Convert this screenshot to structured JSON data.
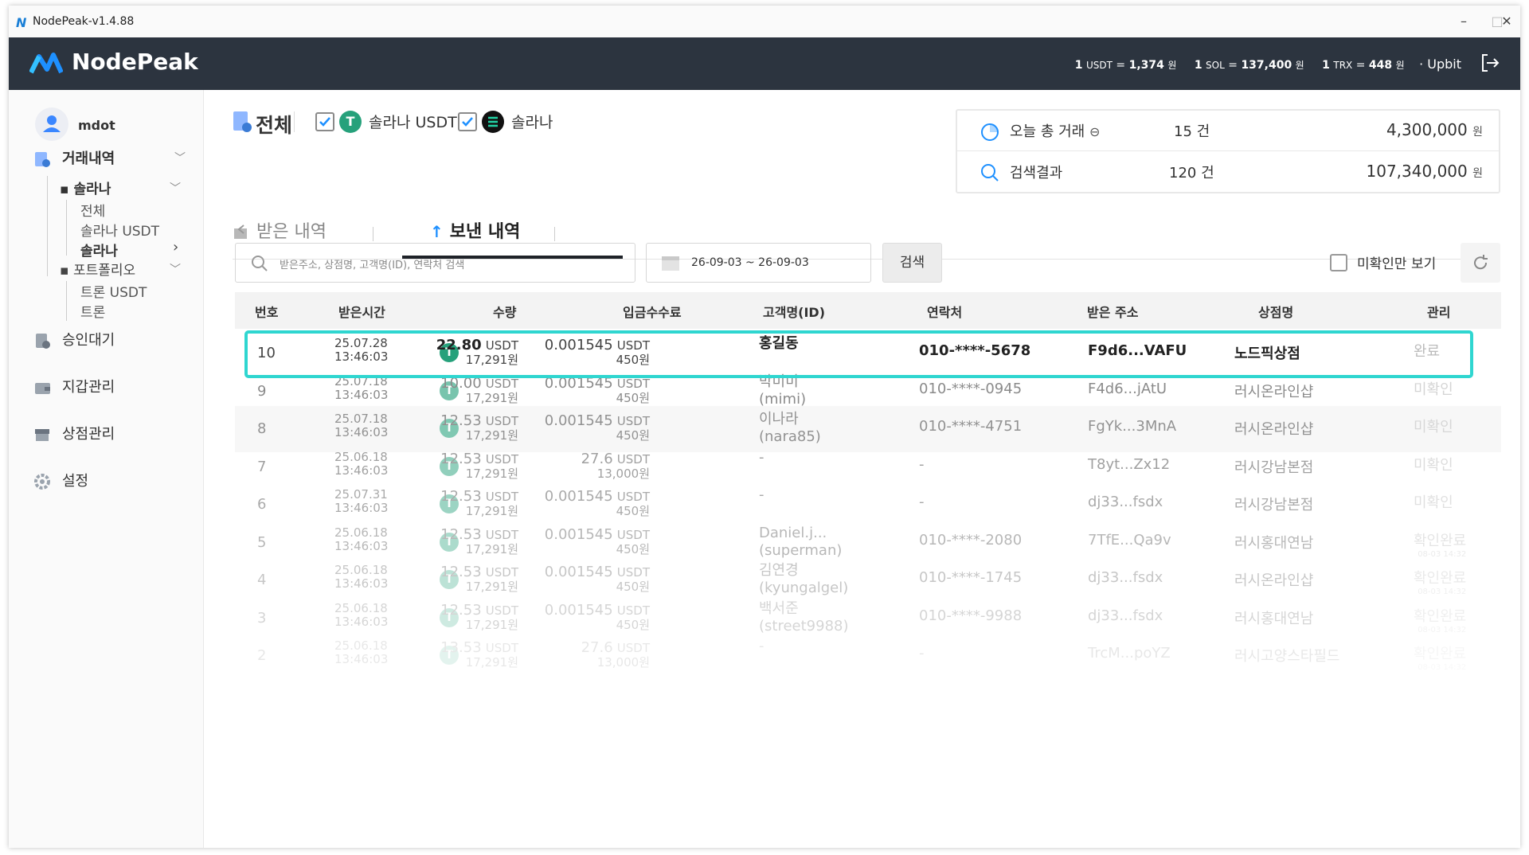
{
  "window": {
    "title": "NodePeak-v1.4.88"
  },
  "header": {
    "brand": "NodePeak",
    "rates": [
      {
        "prefix": "1",
        "unit": "USDT",
        "value": "1,374",
        "won": "원"
      },
      {
        "prefix": "1",
        "unit": "SOL",
        "value": "137,400",
        "won": "원"
      },
      {
        "prefix": "1",
        "unit": "TRX",
        "value": "448",
        "won": "원"
      }
    ],
    "source": "· Upbit"
  },
  "sidebar": {
    "user": "mdot",
    "transactions": "거래내역",
    "solana_group": "솔라나",
    "solana_children": [
      "전체",
      "솔라나 USDT",
      "솔라나"
    ],
    "portfolio_group": "포트폴리오",
    "portfolio_children": [
      "트론 USDT",
      "트론"
    ],
    "items": [
      "승인대기",
      "지갑관리",
      "상점관리",
      "설정"
    ]
  },
  "filter": {
    "all": "전체",
    "usdt": "솔라나 USDT",
    "sol": "솔라나"
  },
  "summary": {
    "today_label": "오늘 총 거래",
    "today_count": "15 건",
    "today_amount": "4,300,000",
    "result_label": "검색결과",
    "result_count": "120 건",
    "result_amount": "107,340,000",
    "won": "원"
  },
  "tabs": {
    "received": "받은 내역",
    "sent": "보낸 내역"
  },
  "search": {
    "placeholder": "받은주소, 상점명, 고객명(ID), 연락처 검색",
    "date_range": "26-09-03 ~ 26-09-03",
    "button": "검색",
    "unconfirmed_only": "미확인만 보기"
  },
  "table": {
    "headers": [
      "번호",
      "받은시간",
      "수량",
      "입금수수료",
      "고객명(ID)",
      "연락처",
      "받은 주소",
      "상점명",
      "관리"
    ],
    "rows": [
      {
        "no": "10",
        "date": "25.07.28",
        "time": "13:46:03",
        "amount": "22.80",
        "unit": "USDT",
        "krw": "17,291원",
        "fee": "0.001545",
        "fee_unit": "USDT",
        "fee_krw": "450원",
        "cust1": "홍길동",
        "cust2": "",
        "phone": "010-****-5678",
        "addr": "F9d6...VAFU",
        "shop": "노드픽상점",
        "status": "완료",
        "status_sub": ""
      },
      {
        "no": "9",
        "date": "25.07.18",
        "time": "13:46:03",
        "amount": "10.00",
        "unit": "USDT",
        "krw": "17,291원",
        "fee": "0.001545",
        "fee_unit": "USDT",
        "fee_krw": "450원",
        "cust1": "박미미",
        "cust2": "(mimi)",
        "phone": "010-****-0945",
        "addr": "F4d6...jAtU",
        "shop": "러시온라인샵",
        "status": "미확인",
        "status_sub": ""
      },
      {
        "no": "8",
        "date": "25.07.18",
        "time": "13:46:03",
        "amount": "12.53",
        "unit": "USDT",
        "krw": "17,291원",
        "fee": "0.001545",
        "fee_unit": "USDT",
        "fee_krw": "450원",
        "cust1": "이나라",
        "cust2": "(nara85)",
        "phone": "010-****-4751",
        "addr": "FgYk...3MnA",
        "shop": "러시온라인샵",
        "status": "미확인",
        "status_sub": ""
      },
      {
        "no": "7",
        "date": "25.06.18",
        "time": "13:46:03",
        "amount": "12.53",
        "unit": "USDT",
        "krw": "17,291원",
        "fee": "27.6",
        "fee_unit": "USDT",
        "fee_krw": "13,000원",
        "cust1": "-",
        "cust2": "",
        "phone": "-",
        "addr": "T8yt...Zx12",
        "shop": "러시강남본점",
        "status": "미확인",
        "status_sub": ""
      },
      {
        "no": "6",
        "date": "25.07.31",
        "time": "13:46:03",
        "amount": "12.53",
        "unit": "USDT",
        "krw": "17,291원",
        "fee": "0.001545",
        "fee_unit": "USDT",
        "fee_krw": "450원",
        "cust1": "-",
        "cust2": "",
        "phone": "-",
        "addr": "dj33...fsdx",
        "shop": "러시강남본점",
        "status": "미확인",
        "status_sub": ""
      },
      {
        "no": "5",
        "date": "25.06.18",
        "time": "13:46:03",
        "amount": "12.53",
        "unit": "USDT",
        "krw": "17,291원",
        "fee": "0.001545",
        "fee_unit": "USDT",
        "fee_krw": "450원",
        "cust1": "Daniel.j...",
        "cust2": "(superman)",
        "phone": "010-****-2080",
        "addr": "7TfE...Qa9v",
        "shop": "러시홍대연남",
        "status": "확인완료",
        "status_sub": "08-03 14:32"
      },
      {
        "no": "4",
        "date": "25.06.18",
        "time": "13:46:03",
        "amount": "12.53",
        "unit": "USDT",
        "krw": "17,291원",
        "fee": "0.001545",
        "fee_unit": "USDT",
        "fee_krw": "450원",
        "cust1": "김연경",
        "cust2": "(kyungalgel)",
        "phone": "010-****-1745",
        "addr": "dj33...fsdx",
        "shop": "러시온라인샵",
        "status": "확인완료",
        "status_sub": "08-03 14:32"
      },
      {
        "no": "3",
        "date": "25.06.18",
        "time": "13:46:03",
        "amount": "12.53",
        "unit": "USDT",
        "krw": "17,291원",
        "fee": "0.001545",
        "fee_unit": "USDT",
        "fee_krw": "450원",
        "cust1": "백서준",
        "cust2": "(street9988)",
        "phone": "010-****-9988",
        "addr": "dj33...fsdx",
        "shop": "러시홍대연남",
        "status": "확인완료",
        "status_sub": "08-03 14:32"
      },
      {
        "no": "2",
        "date": "25.06.18",
        "time": "13:46:03",
        "amount": "13.53",
        "unit": "USDT",
        "krw": "17,291원",
        "fee": "27.6",
        "fee_unit": "USDT",
        "fee_krw": "13,000원",
        "cust1": "-",
        "cust2": "",
        "phone": "-",
        "addr": "TrcM...poYZ",
        "shop": "러시고양스타필드",
        "status": "확인완료",
        "status_sub": "08-03 14:32"
      }
    ]
  },
  "colors": {
    "header_bg": "#2c343f",
    "accent": "#1e90ff",
    "tether": "#26a17b",
    "highlight": "#2fd6d0"
  },
  "icons": [
    "nodepeak-logo-icon",
    "logout-icon",
    "user-icon",
    "list-icon",
    "clock-icon",
    "wallet-icon",
    "store-icon",
    "gear-icon",
    "tether-icon",
    "solana-icon",
    "chart-icon",
    "search-icon",
    "calendar-icon",
    "refresh-icon"
  ]
}
